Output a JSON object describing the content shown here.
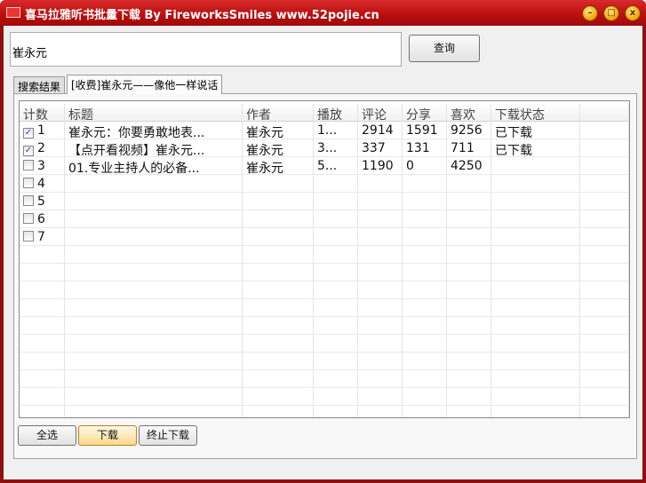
{
  "window": {
    "title": "喜马拉雅听书批量下载 By FireworksSmiles www.52pojie.cn",
    "icon": "app-icon"
  },
  "search": {
    "value": "崔永元",
    "button": "查询"
  },
  "tabs": [
    {
      "label": "搜索结果"
    },
    {
      "label": "[收费]崔永元——像他一样说话"
    }
  ],
  "table": {
    "columns": [
      "计数",
      "标题",
      "作者",
      "播放",
      "评论",
      "分享",
      "喜欢",
      "下载状态"
    ],
    "rows": [
      {
        "checked": true,
        "n": "1",
        "title": "崔永元：你要勇敢地表...",
        "author": "崔永元",
        "play": "1...",
        "comments": "2914",
        "shares": "1591",
        "likes": "9256",
        "status": "已下载"
      },
      {
        "checked": true,
        "n": "2",
        "title": "【点开看视频】崔永元...",
        "author": "崔永元",
        "play": "3...",
        "comments": "337",
        "shares": "131",
        "likes": "711",
        "status": "已下载"
      },
      {
        "checked": false,
        "n": "3",
        "title": "01.专业主持人的必备...",
        "author": "崔永元",
        "play": "5...",
        "comments": "1190",
        "shares": "0",
        "likes": "4250",
        "status": ""
      },
      {
        "checked": false,
        "n": "4"
      },
      {
        "checked": false,
        "n": "5"
      },
      {
        "checked": false,
        "n": "6"
      },
      {
        "checked": false,
        "n": "7"
      }
    ]
  },
  "buttons": {
    "select_all": "全选",
    "download": "下载",
    "stop": "终止下载"
  }
}
